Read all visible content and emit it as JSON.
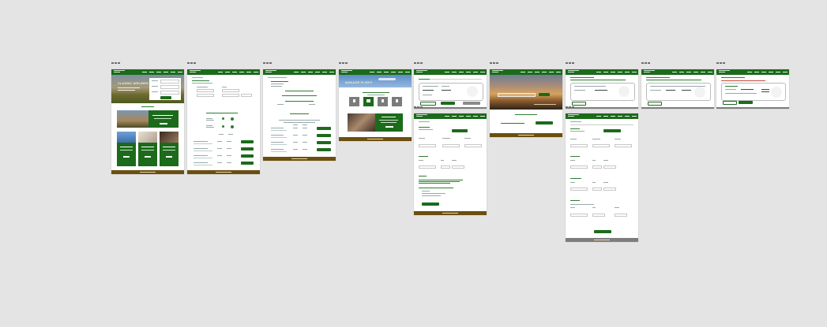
{
  "canvas": {
    "background": "#e4e4e4"
  },
  "theme": {
    "header_green": "#1b6b1b",
    "footer_brown": "#6b4f10",
    "footer_grey": "#7d7d7d"
  },
  "frames": [
    {
      "id": "home",
      "hero_title": "CLASSIC AIRLINES"
    },
    {
      "id": "search-results"
    },
    {
      "id": "booking-details"
    },
    {
      "id": "manage-flight",
      "hero_title": "MANAGE FLIGHT"
    },
    {
      "id": "form-a"
    },
    {
      "id": "sunset-landing"
    },
    {
      "id": "form-b"
    },
    {
      "id": "form-c"
    },
    {
      "id": "form-d"
    }
  ]
}
